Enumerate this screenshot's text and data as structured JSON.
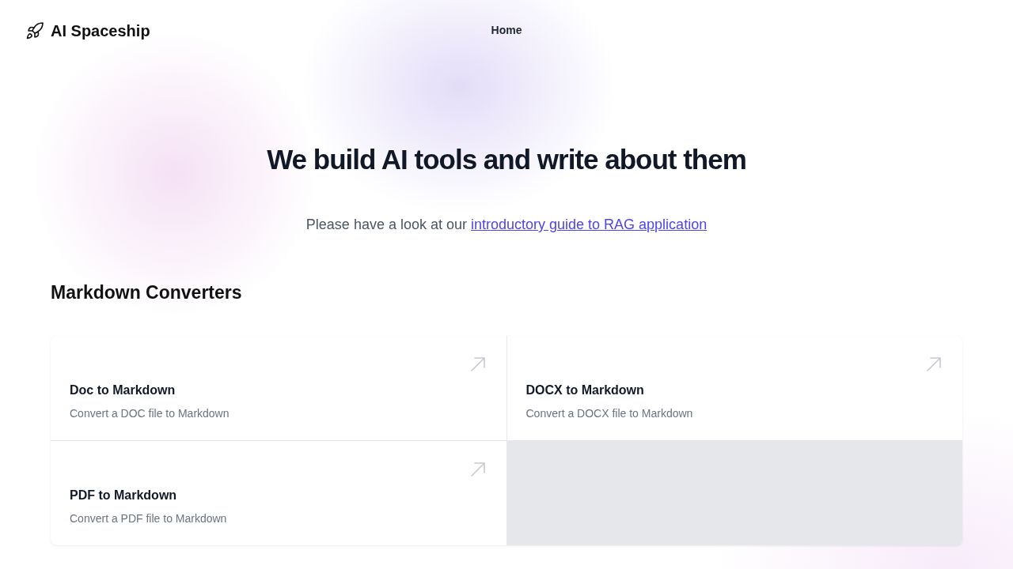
{
  "header": {
    "brand": "AI Spaceship",
    "nav": [
      {
        "label": "Home"
      }
    ]
  },
  "hero": {
    "title": "We build AI tools and write about them",
    "intro": "Please have a look at our ",
    "link": "introductory guide to RAG application"
  },
  "section": {
    "title": "Markdown Converters",
    "cards": [
      {
        "title": "Doc to Markdown",
        "description": "Convert a DOC file to Markdown"
      },
      {
        "title": "DOCX to Markdown",
        "description": "Convert a DOCX file to Markdown"
      },
      {
        "title": "PDF to Markdown",
        "description": "Convert a PDF file to Markdown"
      }
    ]
  }
}
